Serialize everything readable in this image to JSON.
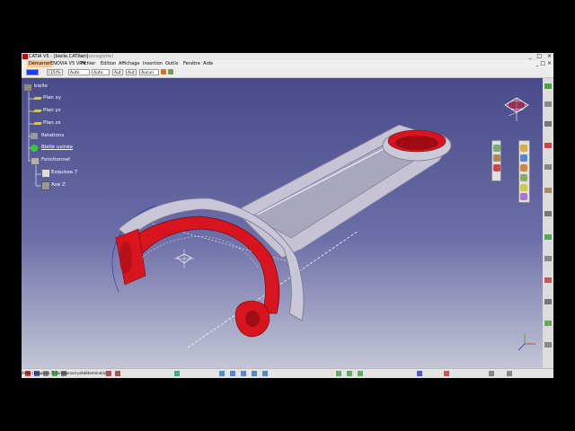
{
  "window": {
    "title": "CATIA V5 - [bielle.CATPart]",
    "subtitle": "(non enregistre)",
    "controls": [
      "_",
      "□",
      "×"
    ]
  },
  "menu": {
    "items": [
      "Démarrer",
      "ENOVIA V5 VPM",
      "Fichier",
      "Edition",
      "Affichage",
      "Insertion",
      "Outils",
      "Fenêtre",
      "Aide"
    ],
    "active_index": 0
  },
  "toolbar": {
    "zoom_value": "(15)%",
    "combo1": "Auto",
    "combo2": "Auto",
    "combo3": "Aut",
    "combo4": "Aut",
    "combo5": "Aucun",
    "color_swatch": "#1a3cff"
  },
  "tree": {
    "root": "bielle",
    "items": [
      {
        "label": "Plan xy",
        "icon": "plane-icon"
      },
      {
        "label": "Plan yz",
        "icon": "plane-icon"
      },
      {
        "label": "Plan zx",
        "icon": "plane-icon"
      },
      {
        "label": "Relations",
        "icon": "relations-icon"
      },
      {
        "label": "Bielle usinée",
        "icon": "gear-icon"
      },
      {
        "label": "Fonctionnel",
        "icon": "functional-icon"
      },
      {
        "label": "Esquisse.7",
        "icon": "sketch-icon"
      },
      {
        "label": "Axe Z",
        "icon": "axis-icon"
      }
    ]
  },
  "status": {
    "text": "Arête (Esquisse.7) Fonctionnel prédéterminé/a)"
  },
  "colors": {
    "part_red": "#d8141e",
    "part_gray": "#c7c5d6",
    "background_top": "#484a8a",
    "background_bottom": "#c4c6d6",
    "menu_highlight": "#f6c89a"
  }
}
